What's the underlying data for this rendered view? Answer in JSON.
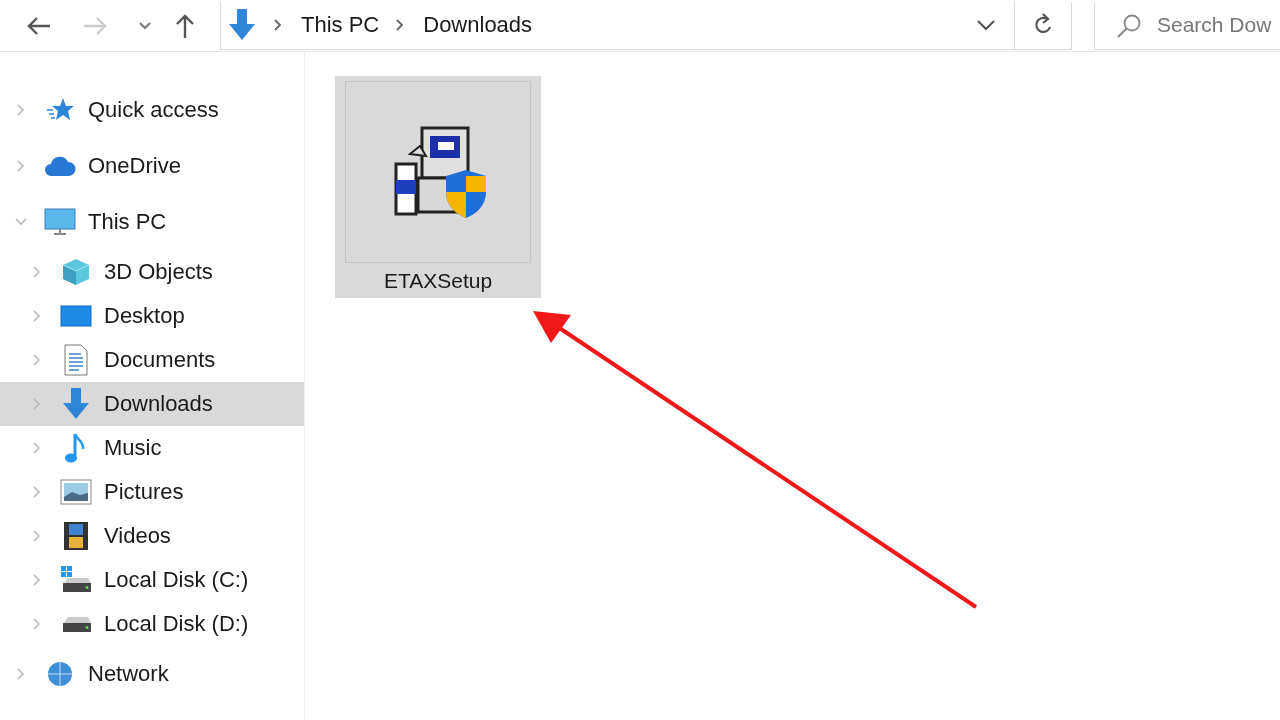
{
  "navigation": {
    "path": [
      {
        "label": "This PC"
      },
      {
        "label": "Downloads"
      }
    ],
    "search": {
      "placeholder": "Search Dow"
    }
  },
  "sidebar": {
    "items": [
      {
        "label": "Quick access",
        "kind": "star",
        "expanded": false,
        "selected": false
      },
      {
        "label": "OneDrive",
        "kind": "cloud",
        "expanded": false,
        "selected": false
      },
      {
        "label": "This PC",
        "kind": "pc",
        "expanded": true,
        "selected": false,
        "children": [
          {
            "label": "3D Objects",
            "kind": "cube",
            "expanded": false,
            "selected": false
          },
          {
            "label": "Desktop",
            "kind": "desktop",
            "expanded": false,
            "selected": false
          },
          {
            "label": "Documents",
            "kind": "document",
            "expanded": false,
            "selected": false
          },
          {
            "label": "Downloads",
            "kind": "download",
            "expanded": false,
            "selected": true
          },
          {
            "label": "Music",
            "kind": "music",
            "expanded": false,
            "selected": false
          },
          {
            "label": "Pictures",
            "kind": "pictures",
            "expanded": false,
            "selected": false
          },
          {
            "label": "Videos",
            "kind": "videos",
            "expanded": false,
            "selected": false
          },
          {
            "label": "Local Disk (C:)",
            "kind": "disk-windows",
            "expanded": false,
            "selected": false
          },
          {
            "label": "Local Disk (D:)",
            "kind": "disk",
            "expanded": false,
            "selected": false
          }
        ]
      },
      {
        "label": "Network",
        "kind": "network",
        "expanded": false,
        "selected": false
      }
    ]
  },
  "files": [
    {
      "name": "ETAXSetup",
      "selected": true
    }
  ]
}
